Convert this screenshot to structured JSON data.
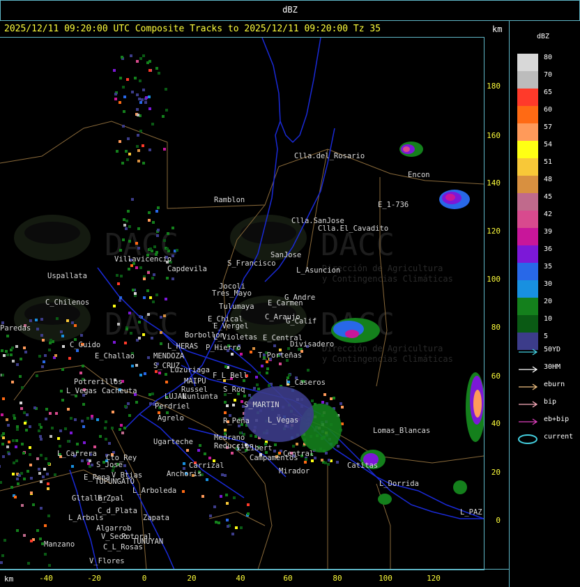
{
  "top_title": "dBZ",
  "header": {
    "text": "2025/12/11 09:20:00 UTC Composite Tracks to 2025/12/11 09:20:00 Tz 35",
    "unit": "km"
  },
  "axes": {
    "unit": "km",
    "y_ticks": [
      "180",
      "160",
      "140",
      "120",
      "100",
      "80",
      "60",
      "40",
      "20",
      "0"
    ],
    "x_ticks": [
      "-40",
      "-20",
      "0",
      "20",
      "40",
      "60",
      "80",
      "100",
      "120"
    ]
  },
  "legend": {
    "title": "dBZ",
    "levels": [
      {
        "value": "80",
        "color": "#d8d8d8"
      },
      {
        "value": "70",
        "color": "#bcbcbc"
      },
      {
        "value": "65",
        "color": "#ff3a2a"
      },
      {
        "value": "60",
        "color": "#ff6a14"
      },
      {
        "value": "57",
        "color": "#ff9a5a"
      },
      {
        "value": "54",
        "color": "#ffff14"
      },
      {
        "value": "51",
        "color": "#f8c838"
      },
      {
        "value": "48",
        "color": "#d89040"
      },
      {
        "value": "45",
        "color": "#c06a8c"
      },
      {
        "value": "42",
        "color": "#d84a8e"
      },
      {
        "value": "39",
        "color": "#c8169a"
      },
      {
        "value": "36",
        "color": "#7c18d8"
      },
      {
        "value": "35",
        "color": "#2868e8"
      },
      {
        "value": "30",
        "color": "#1890e0"
      },
      {
        "value": "20",
        "color": "#14801c"
      },
      {
        "value": "10",
        "color": "#0a5a14"
      },
      {
        "value": "5",
        "color": "#3c3c8a"
      }
    ],
    "tracks": [
      {
        "label": "50YD",
        "color": "#44d0e0",
        "icon": "arrow-icon"
      },
      {
        "label": "30HM",
        "color": "#ffffff",
        "icon": "arrow-icon"
      },
      {
        "label": "eburn",
        "color": "#f0c080",
        "icon": "arrow-icon"
      },
      {
        "label": "bip",
        "color": "#ffb0c0",
        "icon": "arrow-icon"
      },
      {
        "label": "eb+bip",
        "color": "#e040c0",
        "icon": "arrow-icon"
      },
      {
        "label": "current",
        "color": "#44d0e0",
        "icon": "ellipse-icon"
      }
    ]
  },
  "watermark": {
    "logo_text": "DACC",
    "line1": "Dirección de Agricultura",
    "line2": "y Contingencias Climáticas"
  },
  "places": [
    "Clla.del_Rosario",
    "Encon",
    "E_1-736",
    "Ramblon",
    "Clla.SanJose",
    "Clla.El_Cavadito",
    "Villavicencio",
    "S_Francisco",
    "SanJose",
    "Uspallata",
    "Capdevila",
    "L_Asuncion",
    "C_Chilenos",
    "Tres_Mayo",
    "Jocoli",
    "Tulumaya",
    "E_Carmen",
    "G_Andre",
    "E_Chical",
    "E_Vergel",
    "C_Araujo",
    "G_Calif",
    "Paredas",
    "C_Guido",
    "Borbollon",
    "L_Violetas",
    "E_Central",
    "Divisadero",
    "L_HERAS",
    "P_Hierro",
    "T_Porteñas",
    "E_Challao",
    "MENDOZA",
    "S_CRUZ",
    "Luzuriaga",
    "F_L_Bell",
    "L_Caseros",
    "Potrerillos",
    "Cacheuta",
    "MAIPU",
    "Russel",
    "S_Roq",
    "L_Vegas",
    "LUJAN",
    "Lunlunta",
    "Perdriel",
    "S_MARTIN",
    "Agrelo",
    "R_Peña",
    "L_Vegas",
    "Lomas_Blancas",
    "Ugarteche",
    "Medrano",
    "Reduccion",
    "Catitas",
    "L_Carrera",
    "Cto_Rey",
    "S_Jose",
    "L_Libert",
    "Campamentos",
    "Central",
    "L_Dorrida",
    "Carrizal",
    "E_Pena",
    "V_Btias",
    "Anchoris",
    "TUPUNGATO",
    "L_Arboleda",
    "Mirador",
    "Gltallar",
    "E_Zpal",
    "C_d_Plata",
    "L_Arbols",
    "Zapata",
    "Algarrob",
    "V_Seco",
    "Potoral",
    "Manzano",
    "TUNUYAN",
    "C_L_Rosas",
    "V_Flores",
    "L_PAZ"
  ]
}
